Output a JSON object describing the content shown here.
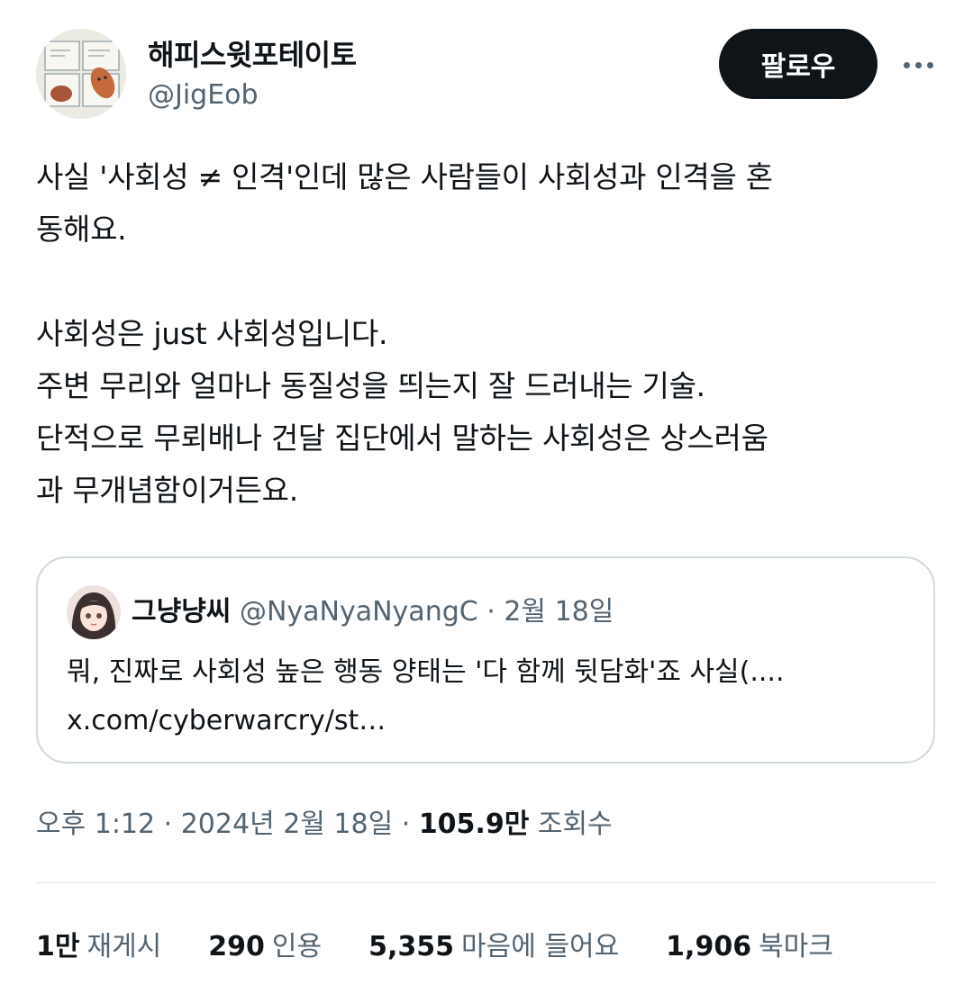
{
  "author": {
    "display_name": "해피스윗포테이토",
    "handle": "@JigEob",
    "avatar_icon": "sweet-potato-comic-avatar"
  },
  "header": {
    "follow_label": "팔로우",
    "more_icon": "more-horizontal-icon"
  },
  "tweet": {
    "lines": [
      "사실 '사회성 ≠ 인격'인데 많은 사람들이 사회성과 인격을 혼\n동해요.",
      "",
      "사회성은 just 사회성입니다.\n주변 무리와 얼마나 동질성을 띄는지 잘 드러내는 기술.\n단적으로 무뢰배나 건달 집단에서 말하는 사회성은 상스러움\n과 무개념함이거든요."
    ]
  },
  "quote": {
    "name": "그냥냥씨",
    "handle": "@NyaNyaNyangC",
    "separator": "·",
    "date": "2월 18일",
    "text": "뭐, 진짜로 사회성 높은 행동 양태는 '다 함께 뒷담화'죠 사실(....\nx.com/cyberwarcry/st…",
    "avatar_icon": "anime-girl-avatar"
  },
  "meta": {
    "time": "오후 1:12",
    "sep1": " · ",
    "date": "2024년 2월 18일",
    "sep2": " · ",
    "views_count": "105.9만",
    "views_label": "조회수"
  },
  "stats": [
    {
      "count": "1만",
      "label": "재게시"
    },
    {
      "count": "290",
      "label": "인용"
    },
    {
      "count": "5,355",
      "label": "마음에 들어요"
    },
    {
      "count": "1,906",
      "label": "북마크"
    }
  ],
  "colors": {
    "text": "#0f1419",
    "secondary": "#536471",
    "border": "#cfd9de",
    "button_bg": "#0f1419"
  }
}
